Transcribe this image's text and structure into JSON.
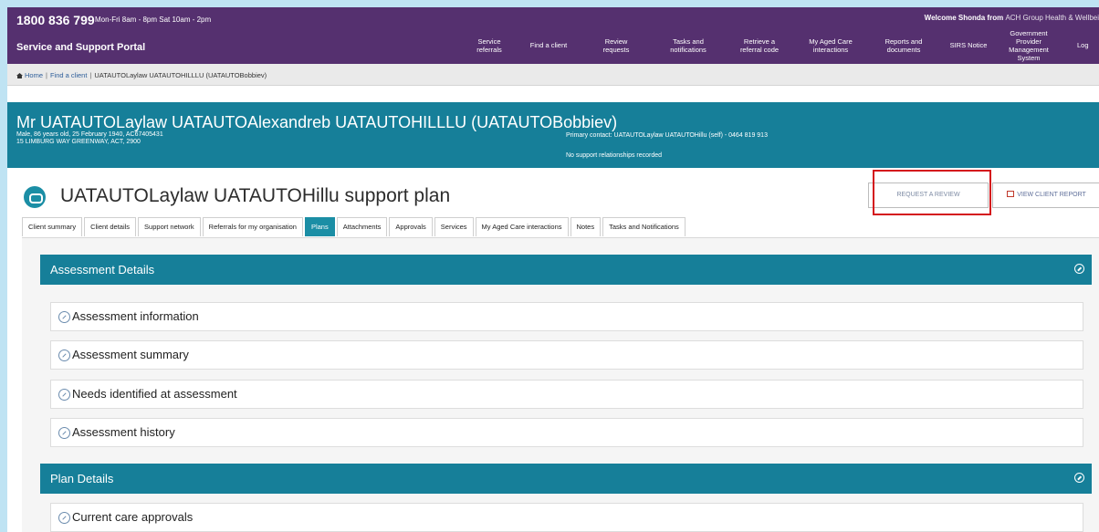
{
  "topbar": {
    "phone": "1800 836 799",
    "hours": "Mon-Fri 8am - 8pm Sat 10am - 2pm",
    "welcome": "Welcome Shonda from",
    "org": "ACH Group Health & Wellbei",
    "portal_title": "Service and Support Portal",
    "nav": [
      {
        "label": "Service referrals"
      },
      {
        "label": "Find a client"
      },
      {
        "label": "Review requests"
      },
      {
        "label": "Tasks and notifications"
      },
      {
        "label": "Retrieve a referral code"
      },
      {
        "label": "My Aged Care interactions"
      },
      {
        "label": "Reports and documents"
      },
      {
        "label": "SIRS Notice"
      },
      {
        "label": "Government Provider Management System"
      },
      {
        "label": "Log"
      }
    ]
  },
  "breadcrumb": {
    "home": "Home",
    "find_client": "Find a client",
    "current": "UATAUTOLaylaw UATAUTOHILLLU (UATAUTOBobbiev)"
  },
  "client": {
    "name": "Mr UATAUTOLaylaw UATAUTOAlexandreb UATAUTOHILLLU (UATAUTOBobbiev)",
    "details": "Male, 86 years old, 25 February 1940, AC67405431",
    "address": "15 LIMBURG WAY GREENWAY, ACT, 2900",
    "primary_contact": "Primary contact: UATAUTOLaylaw UATAUTOHillu (self) - 0464 819 913",
    "relationships": "No support relationships recorded"
  },
  "plan": {
    "title": "UATAUTOLaylaw UATAUTOHillu support plan",
    "request_review": "REQUEST A REVIEW",
    "view_report": "VIEW CLIENT REPORT"
  },
  "tabs": [
    {
      "label": "Client summary"
    },
    {
      "label": "Client details"
    },
    {
      "label": "Support network"
    },
    {
      "label": "Referrals for my organisation"
    },
    {
      "label": "Plans"
    },
    {
      "label": "Attachments"
    },
    {
      "label": "Approvals"
    },
    {
      "label": "Services"
    },
    {
      "label": "My Aged Care interactions"
    },
    {
      "label": "Notes"
    },
    {
      "label": "Tasks and Notifications"
    }
  ],
  "sections": {
    "assessment": {
      "title": "Assessment Details",
      "rows": [
        {
          "label": "Assessment information"
        },
        {
          "label": "Assessment summary"
        },
        {
          "label": "Needs identified at assessment"
        },
        {
          "label": "Assessment history"
        }
      ]
    },
    "plan": {
      "title": "Plan Details",
      "rows": [
        {
          "label": "Current care approvals"
        }
      ]
    }
  },
  "colors": {
    "purple_bar": "#55306f",
    "teal": "#167f99",
    "highlight_red": "#d4141c",
    "active_tab": "#1b8ea5"
  }
}
